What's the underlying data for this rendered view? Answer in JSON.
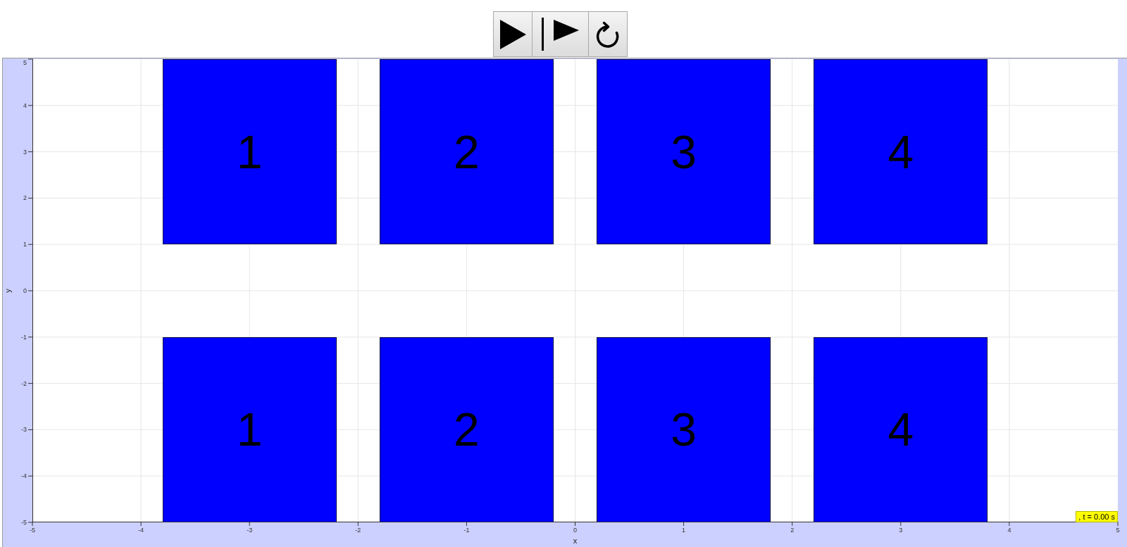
{
  "toolbar": {
    "buttons": [
      {
        "kind": "play"
      },
      {
        "kind": "step"
      },
      {
        "kind": "reset"
      }
    ]
  },
  "plot": {
    "x_axis": {
      "label": "x",
      "ticks": [
        "-5",
        "-4",
        "-3",
        "-2",
        "-1",
        "0",
        "1",
        "2",
        "3",
        "4",
        "5"
      ]
    },
    "y_axis": {
      "label": "y",
      "ticks": [
        "5",
        "4",
        "3",
        "2",
        "1",
        "0",
        "-1",
        "-2",
        "-3",
        "-4",
        "-5"
      ]
    },
    "rows": [
      {
        "blocks": [
          {
            "label": "1"
          },
          {
            "label": "2"
          },
          {
            "label": "3"
          },
          {
            "label": "4"
          }
        ]
      },
      {
        "blocks": [
          {
            "label": "1"
          },
          {
            "label": "2"
          },
          {
            "label": "3"
          },
          {
            "label": "4"
          }
        ]
      }
    ],
    "time_readout": ", t = 0.00 s"
  }
}
